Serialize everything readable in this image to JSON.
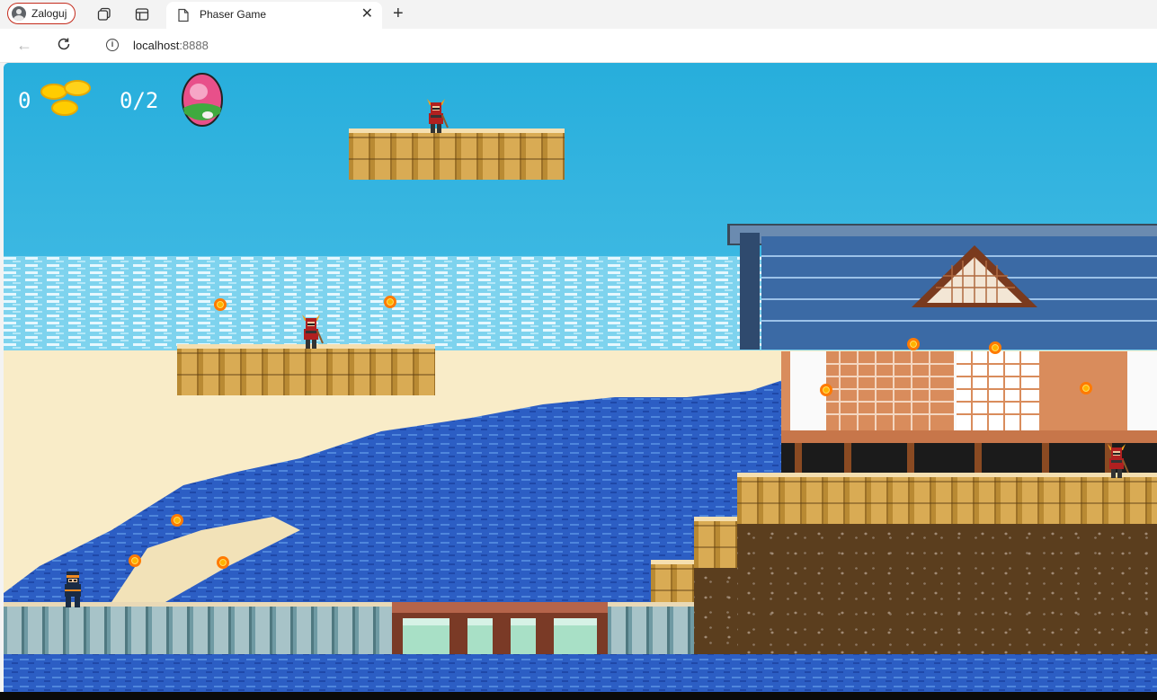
{
  "browser": {
    "profile_label": "Zaloguj",
    "tab_title": "Phaser Game",
    "url_host": "localhost",
    "url_port": ":8888"
  },
  "hud": {
    "coins_count": "0",
    "eggs_progress": "0/2",
    "coin_icon": "gold-coins-icon",
    "egg_icon": "pink-egg-icon"
  },
  "colors": {
    "sky": "#2fb0dc",
    "sea": "#2f62c8",
    "sand": "#f9ecc8",
    "platform": "#d2a24e",
    "roof": "#3b6aa5",
    "samurai": "#b02020",
    "ninja": "#1a2b44",
    "coin": "#ffb300"
  }
}
